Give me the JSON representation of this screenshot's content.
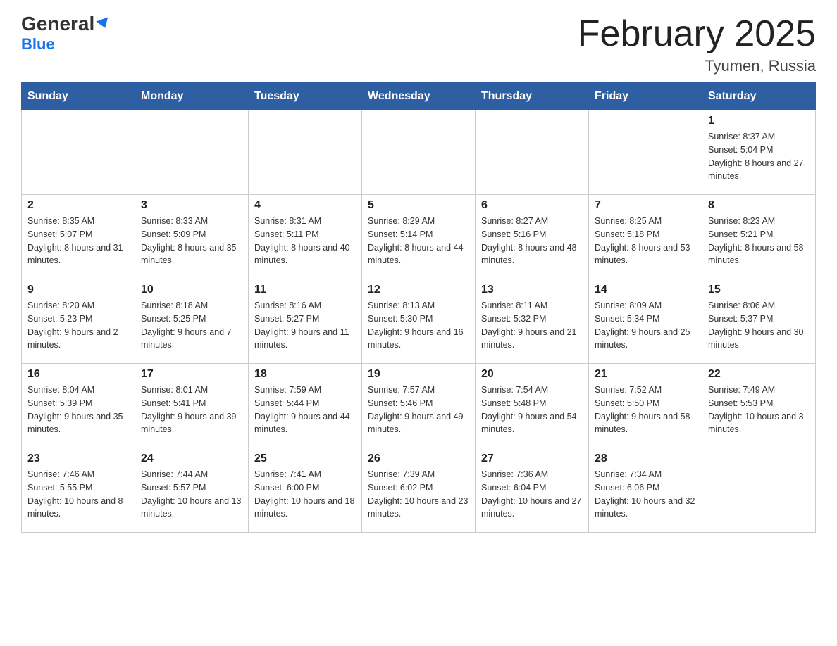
{
  "header": {
    "logo_line1": "General",
    "logo_line2": "Blue",
    "main_title": "February 2025",
    "subtitle": "Tyumen, Russia"
  },
  "days_of_week": [
    "Sunday",
    "Monday",
    "Tuesday",
    "Wednesday",
    "Thursday",
    "Friday",
    "Saturday"
  ],
  "weeks": [
    [
      {
        "day": "",
        "info": ""
      },
      {
        "day": "",
        "info": ""
      },
      {
        "day": "",
        "info": ""
      },
      {
        "day": "",
        "info": ""
      },
      {
        "day": "",
        "info": ""
      },
      {
        "day": "",
        "info": ""
      },
      {
        "day": "1",
        "info": "Sunrise: 8:37 AM\nSunset: 5:04 PM\nDaylight: 8 hours and 27 minutes."
      }
    ],
    [
      {
        "day": "2",
        "info": "Sunrise: 8:35 AM\nSunset: 5:07 PM\nDaylight: 8 hours and 31 minutes."
      },
      {
        "day": "3",
        "info": "Sunrise: 8:33 AM\nSunset: 5:09 PM\nDaylight: 8 hours and 35 minutes."
      },
      {
        "day": "4",
        "info": "Sunrise: 8:31 AM\nSunset: 5:11 PM\nDaylight: 8 hours and 40 minutes."
      },
      {
        "day": "5",
        "info": "Sunrise: 8:29 AM\nSunset: 5:14 PM\nDaylight: 8 hours and 44 minutes."
      },
      {
        "day": "6",
        "info": "Sunrise: 8:27 AM\nSunset: 5:16 PM\nDaylight: 8 hours and 48 minutes."
      },
      {
        "day": "7",
        "info": "Sunrise: 8:25 AM\nSunset: 5:18 PM\nDaylight: 8 hours and 53 minutes."
      },
      {
        "day": "8",
        "info": "Sunrise: 8:23 AM\nSunset: 5:21 PM\nDaylight: 8 hours and 58 minutes."
      }
    ],
    [
      {
        "day": "9",
        "info": "Sunrise: 8:20 AM\nSunset: 5:23 PM\nDaylight: 9 hours and 2 minutes."
      },
      {
        "day": "10",
        "info": "Sunrise: 8:18 AM\nSunset: 5:25 PM\nDaylight: 9 hours and 7 minutes."
      },
      {
        "day": "11",
        "info": "Sunrise: 8:16 AM\nSunset: 5:27 PM\nDaylight: 9 hours and 11 minutes."
      },
      {
        "day": "12",
        "info": "Sunrise: 8:13 AM\nSunset: 5:30 PM\nDaylight: 9 hours and 16 minutes."
      },
      {
        "day": "13",
        "info": "Sunrise: 8:11 AM\nSunset: 5:32 PM\nDaylight: 9 hours and 21 minutes."
      },
      {
        "day": "14",
        "info": "Sunrise: 8:09 AM\nSunset: 5:34 PM\nDaylight: 9 hours and 25 minutes."
      },
      {
        "day": "15",
        "info": "Sunrise: 8:06 AM\nSunset: 5:37 PM\nDaylight: 9 hours and 30 minutes."
      }
    ],
    [
      {
        "day": "16",
        "info": "Sunrise: 8:04 AM\nSunset: 5:39 PM\nDaylight: 9 hours and 35 minutes."
      },
      {
        "day": "17",
        "info": "Sunrise: 8:01 AM\nSunset: 5:41 PM\nDaylight: 9 hours and 39 minutes."
      },
      {
        "day": "18",
        "info": "Sunrise: 7:59 AM\nSunset: 5:44 PM\nDaylight: 9 hours and 44 minutes."
      },
      {
        "day": "19",
        "info": "Sunrise: 7:57 AM\nSunset: 5:46 PM\nDaylight: 9 hours and 49 minutes."
      },
      {
        "day": "20",
        "info": "Sunrise: 7:54 AM\nSunset: 5:48 PM\nDaylight: 9 hours and 54 minutes."
      },
      {
        "day": "21",
        "info": "Sunrise: 7:52 AM\nSunset: 5:50 PM\nDaylight: 9 hours and 58 minutes."
      },
      {
        "day": "22",
        "info": "Sunrise: 7:49 AM\nSunset: 5:53 PM\nDaylight: 10 hours and 3 minutes."
      }
    ],
    [
      {
        "day": "23",
        "info": "Sunrise: 7:46 AM\nSunset: 5:55 PM\nDaylight: 10 hours and 8 minutes."
      },
      {
        "day": "24",
        "info": "Sunrise: 7:44 AM\nSunset: 5:57 PM\nDaylight: 10 hours and 13 minutes."
      },
      {
        "day": "25",
        "info": "Sunrise: 7:41 AM\nSunset: 6:00 PM\nDaylight: 10 hours and 18 minutes."
      },
      {
        "day": "26",
        "info": "Sunrise: 7:39 AM\nSunset: 6:02 PM\nDaylight: 10 hours and 23 minutes."
      },
      {
        "day": "27",
        "info": "Sunrise: 7:36 AM\nSunset: 6:04 PM\nDaylight: 10 hours and 27 minutes."
      },
      {
        "day": "28",
        "info": "Sunrise: 7:34 AM\nSunset: 6:06 PM\nDaylight: 10 hours and 32 minutes."
      },
      {
        "day": "",
        "info": ""
      }
    ]
  ]
}
